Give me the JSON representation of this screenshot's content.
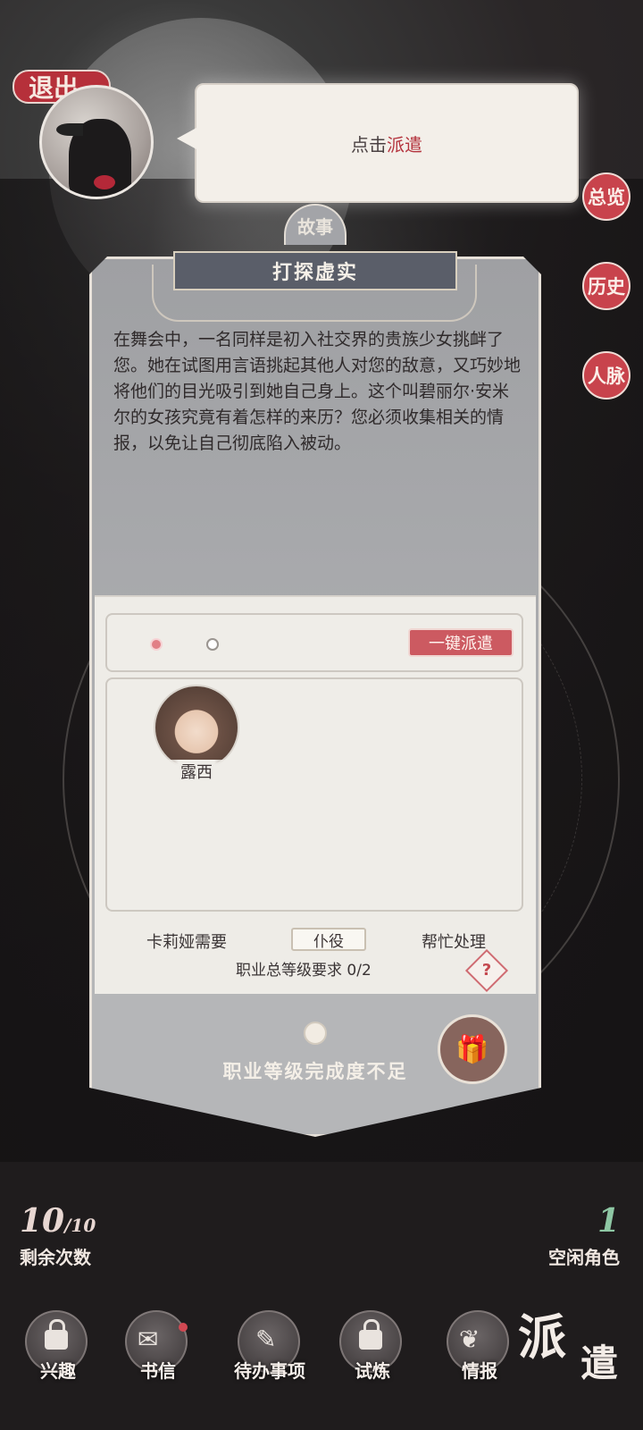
{
  "exit_label": "退出",
  "speech": {
    "prefix": "点击",
    "highlight": "派遣"
  },
  "side_buttons": [
    "总览",
    "历史",
    "人脉"
  ],
  "story": {
    "tag": "故事",
    "title": "打探虚实",
    "text": "在舞会中，一名同样是初入社交界的贵族少女挑衅了您。她在试图用言语挑起其他人对您的敌意，又巧妙地将他们的目光吸引到她自己身上。这个叫碧丽尔·安米尔的女孩究竟有着怎样的来历？您必须收集相关的情报，以免让自己彻底陷入被动。"
  },
  "dispatch": {
    "one_key_label": "一键派遣",
    "role_name": "露西",
    "req_prefix": "卡莉娅需要",
    "req_job": "仆役",
    "req_suffix": "帮忙处理",
    "req_level": "职业总等级要求 0/2",
    "help_symbol": "?",
    "insufficient": "职业等级完成度不足"
  },
  "stats": {
    "remaining_num": "10",
    "remaining_den": "10",
    "remaining_label": "剩余次数",
    "idle_num": "1",
    "idle_label": "空闲角色"
  },
  "nav": [
    "兴趣",
    "书信",
    "待办事项",
    "试炼",
    "情报"
  ],
  "screen_title_a": "派",
  "screen_title_b": "遣",
  "colors": {
    "accent": "#c8434c",
    "panel": "#eeece7",
    "card": "#a9aaad"
  }
}
